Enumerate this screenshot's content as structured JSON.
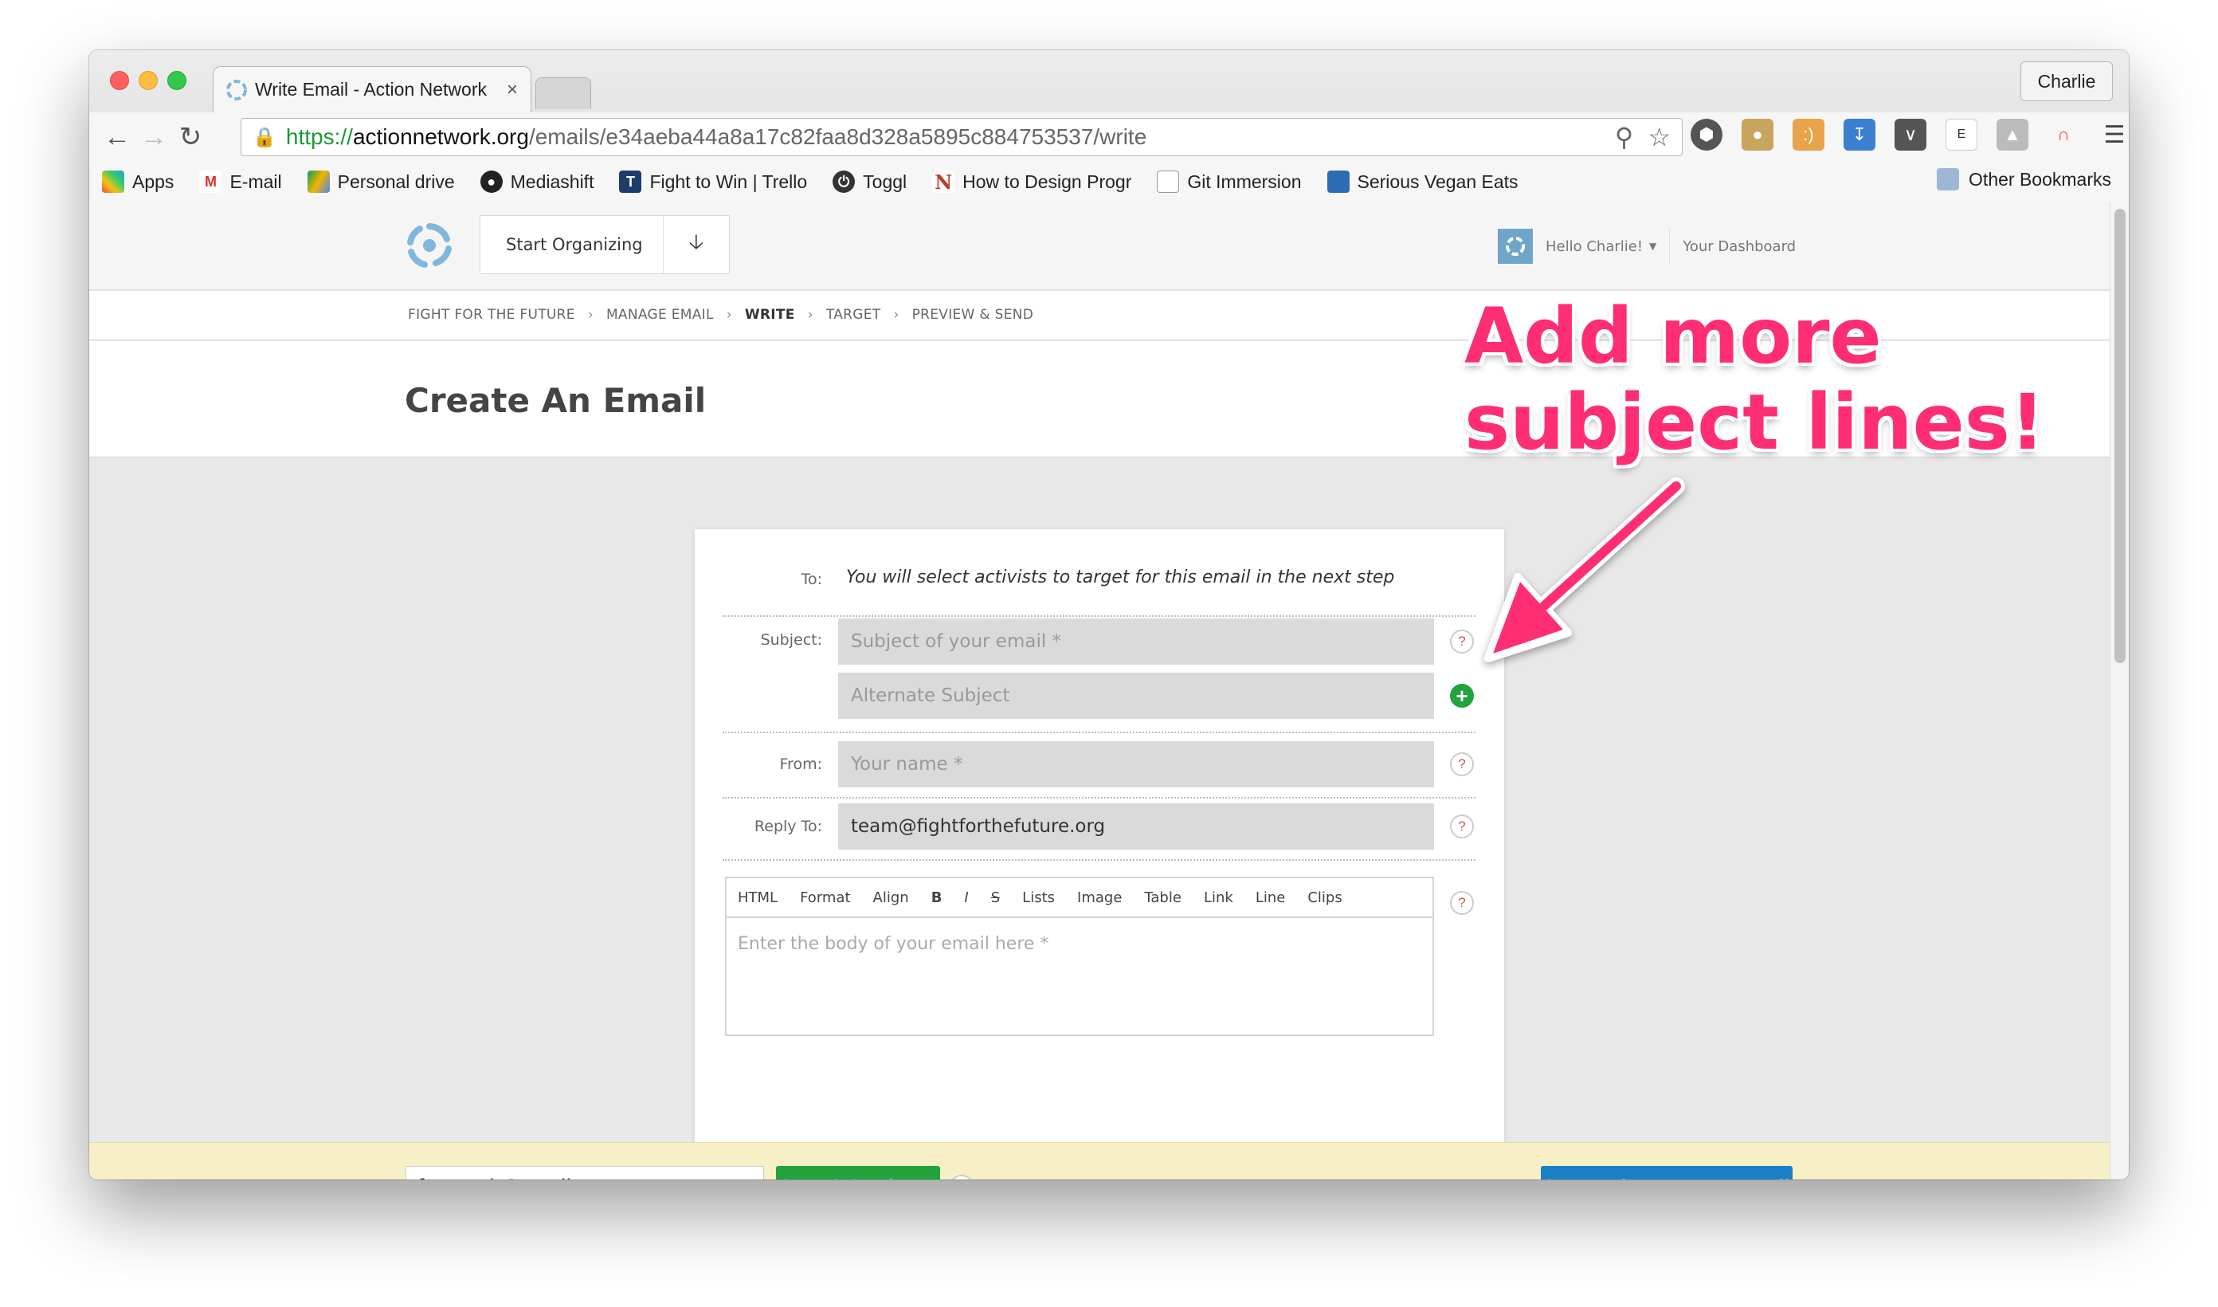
{
  "browser": {
    "tab_title": "Write Email - Action Network",
    "profile": "Charlie",
    "url_scheme": "https://",
    "url_host": "actionnetwork.org",
    "url_path": "/emails/e34aeba44a8a17c82faa8d328a5895c884753537/write",
    "bookmarks": [
      "Apps",
      "E-mail",
      "Personal drive",
      "Mediashift",
      "Fight to Win | Trello",
      "Toggl",
      "How to Design Progr",
      "Git Immersion",
      "Serious Vegan Eats"
    ],
    "other_bookmarks": "Other Bookmarks",
    "extensions": [
      "E"
    ]
  },
  "header": {
    "org_button": "Start Organizing",
    "greeting": "Hello Charlie!",
    "dashboard_link": "Your Dashboard"
  },
  "breadcrumb": [
    "FIGHT FOR THE FUTURE",
    "MANAGE EMAIL",
    "WRITE",
    "TARGET",
    "PREVIEW & SEND"
  ],
  "page_title": "Create An Email",
  "form": {
    "to_label": "To:",
    "to_text": "You will select activists to target for this email in the next step",
    "subject_label": "Subject:",
    "subject_placeholder": "Subject of your email *",
    "alt_subject_placeholder": "Alternate Subject",
    "from_label": "From:",
    "from_placeholder": "Your name *",
    "reply_label": "Reply To:",
    "reply_value": "team@fightforthefuture.org",
    "help_glyph": "?",
    "add_glyph": "+",
    "editor_tools": [
      "HTML",
      "Format",
      "Align",
      "B",
      "I",
      "S",
      "Lists",
      "Image",
      "Table",
      "Link",
      "Line",
      "Clips"
    ],
    "editor_placeholder": "Enter the body of your email here *"
  },
  "footer": {
    "test_email": "furman.jr@gmail.com",
    "send_test": "Save & Send Test",
    "target_button": "Save and Target Your Email"
  },
  "annotation": {
    "line1": "Add more",
    "line2": "subject lines!",
    "color": "#ff2d73"
  }
}
